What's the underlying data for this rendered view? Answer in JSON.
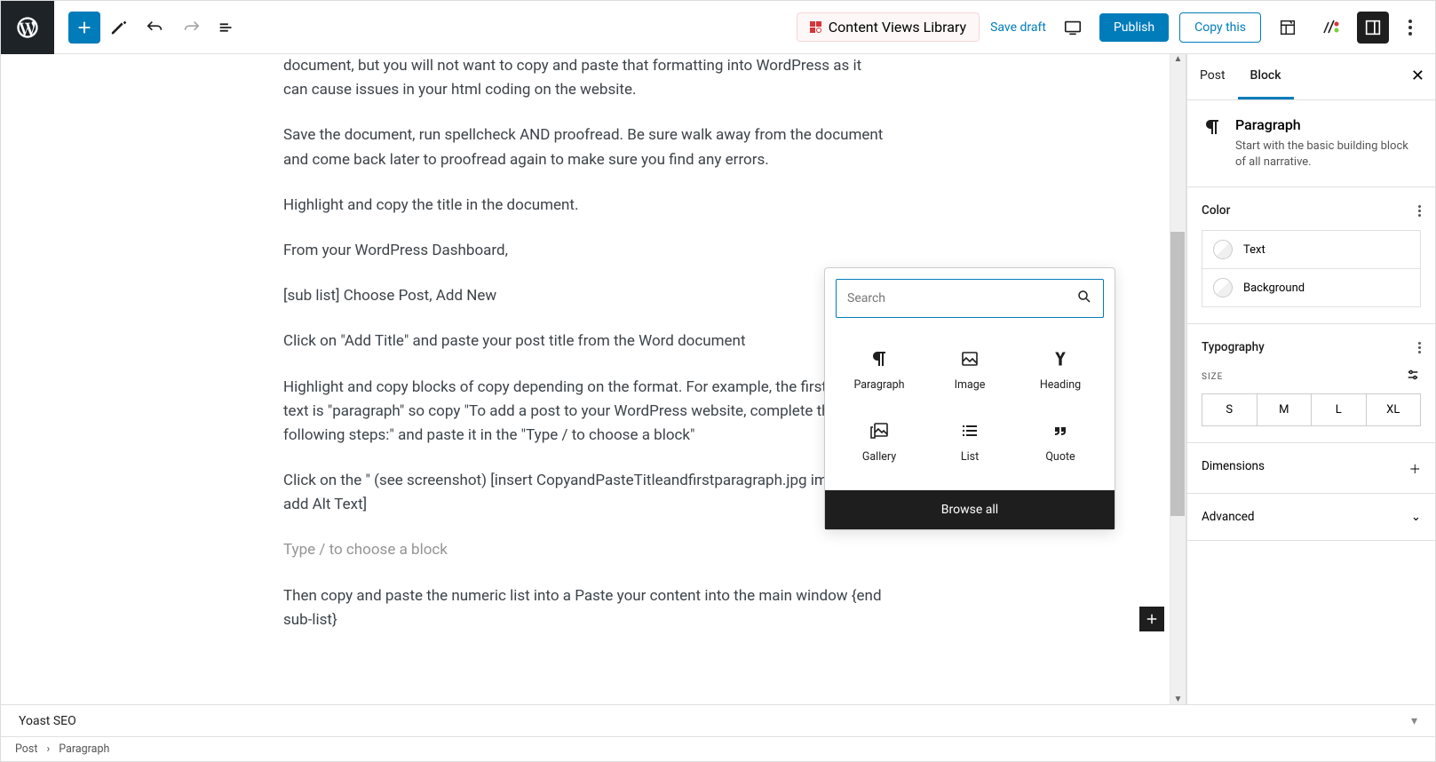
{
  "toolbar": {
    "cvlib": "Content Views Library",
    "save_draft": "Save draft",
    "publish": "Publish",
    "copy_this": "Copy this"
  },
  "content": {
    "p0": "document, but you will not want to copy and paste that formatting into WordPress as it can cause issues in your html coding on the website.",
    "p1": "Save the document, run spellcheck AND proofread. Be sure walk away from the document and come back later to proofread again to make sure you find any errors.",
    "p2": "Highlight and copy the title in the document.",
    "p3": "From your WordPress Dashboard,",
    "p4": "[sub list] Choose Post, Add New",
    "p5": "Click on \"Add Title\" and paste your post title from the Word document",
    "p6": "Highlight and copy blocks of copy depending on the format. For example, the first line of text is \"paragraph\" so copy \"To add a post to your WordPress website, complete the following steps:\" and paste it in the \"Type / to choose a block\"",
    "p7": "Click on the \" (see screenshot) [insert CopyandPasteTitleandfirstparagraph.jpg image and add Alt Text]",
    "p8_placeholder": "Type / to choose a block",
    "p9": "Then copy and paste the numeric list into a Paste your content into the main window {end sub-list}"
  },
  "inserter": {
    "search_placeholder": "Search",
    "blocks": {
      "paragraph": "Paragraph",
      "image": "Image",
      "heading": "Heading",
      "gallery": "Gallery",
      "list": "List",
      "quote": "Quote"
    },
    "browse_all": "Browse all"
  },
  "sidebar": {
    "tabs": {
      "post": "Post",
      "block": "Block"
    },
    "block_name": "Paragraph",
    "block_desc": "Start with the basic building block of all narrative.",
    "panels": {
      "color": "Color",
      "color_text": "Text",
      "color_bg": "Background",
      "typography": "Typography",
      "dimensions": "Dimensions",
      "advanced": "Advanced",
      "size_label": "SIZE"
    },
    "sizes": {
      "s": "S",
      "m": "M",
      "l": "L",
      "xl": "XL"
    }
  },
  "footer": {
    "yoast": "Yoast SEO",
    "breadcrumb_root": "Post",
    "breadcrumb_leaf": "Paragraph"
  }
}
